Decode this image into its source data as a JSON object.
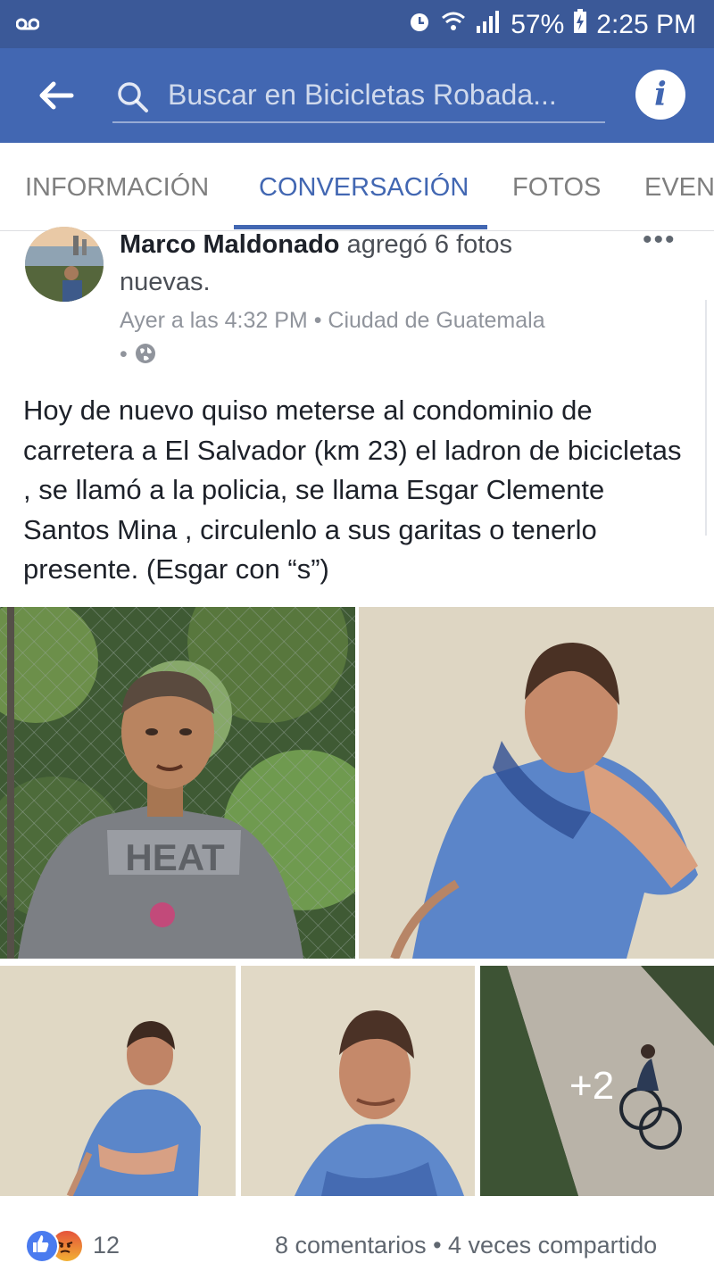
{
  "status_bar": {
    "left_icon": "voicemail-icon",
    "battery": "57%",
    "time": "2:25 PM"
  },
  "app_bar": {
    "search_placeholder": "Buscar en Bicicletas Robada...",
    "back_icon": "back-arrow-icon",
    "info_icon": "info-icon",
    "info_glyph": "i"
  },
  "tabs": [
    {
      "label": "INFORMACIÓN",
      "active": false
    },
    {
      "label": "CONVERSACIÓN",
      "active": true
    },
    {
      "label": "FOTOS",
      "active": false
    },
    {
      "label": "EVEN",
      "active": false
    }
  ],
  "post": {
    "author": "Marco Maldonado",
    "action_line1": "agregó 6 fotos",
    "action_line2": "nuevas.",
    "time_location": "Ayer a las 4:32 PM • Ciudad de Guatemala",
    "privacy_dot": "•",
    "more": "•••",
    "text": "Hoy de nuevo quiso meterse al condominio de carretera a El Salvador (km 23) el ladron de bicicletas ,  se llamó a la policia, se llama Esgar Clemente Santos Mina , circulenlo a sus garitas o tenerlo presente.   (Esgar con “s”)",
    "more_photos": "+2"
  },
  "footer": {
    "reaction_count": "12",
    "comments_shares": "8 comentarios • 4 veces compartido"
  },
  "colors": {
    "brand": "#4267b2",
    "status_bar": "#3b5998"
  }
}
